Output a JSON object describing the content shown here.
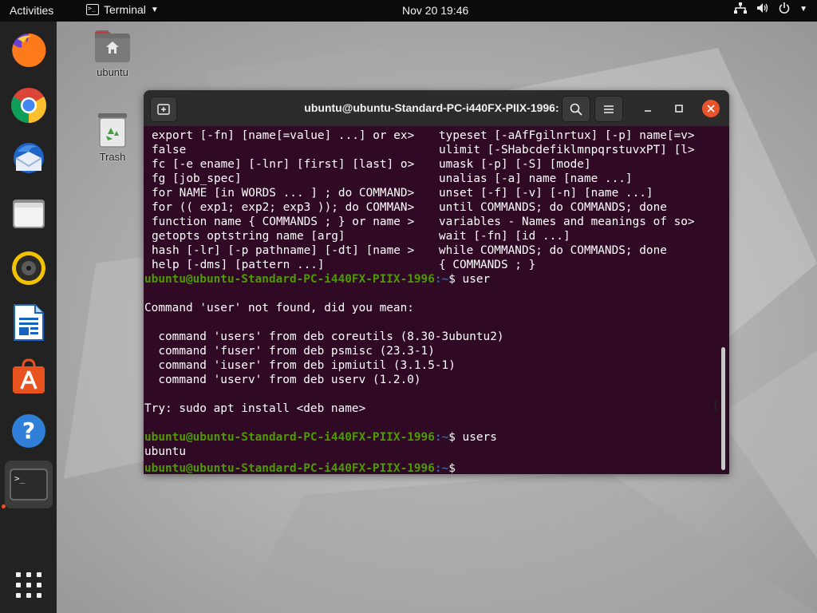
{
  "topbar": {
    "activities": "Activities",
    "app_name": "Terminal",
    "clock": "Nov 20  19:46"
  },
  "dock": {
    "items": [
      "firefox",
      "chrome",
      "thunderbird",
      "files",
      "rhythmbox",
      "libreoffice-writer",
      "ubuntu-software",
      "help",
      "terminal",
      "show-applications"
    ]
  },
  "desktop": {
    "home_label": "ubuntu",
    "trash_label": "Trash"
  },
  "window": {
    "title": "ubuntu@ubuntu-Standard-PC-i440FX-PIIX-1996: ~"
  },
  "terminal": {
    "help_rows": [
      {
        "left": "export [-fn] [name[=value] ...] or ex>",
        "right": "typeset [-aAfFgilnrtux] [-p] name[=v>"
      },
      {
        "left": "false",
        "right": "ulimit [-SHabcdefiklmnpqrstuvxPT] [l>"
      },
      {
        "left": "fc [-e ename] [-lnr] [first] [last] o>",
        "right": "umask [-p] [-S] [mode]"
      },
      {
        "left": "fg [job_spec]",
        "right": "unalias [-a] name [name ...]"
      },
      {
        "left": "for NAME [in WORDS ... ] ; do COMMAND>",
        "right": "unset [-f] [-v] [-n] [name ...]"
      },
      {
        "left": "for (( exp1; exp2; exp3 )); do COMMAN>",
        "right": "until COMMANDS; do COMMANDS; done"
      },
      {
        "left": "function name { COMMANDS ; } or name >",
        "right": "variables - Names and meanings of so>"
      },
      {
        "left": "getopts optstring name [arg]",
        "right": "wait [-fn] [id ...]"
      },
      {
        "left": "hash [-lr] [-p pathname] [-dt] [name >",
        "right": "while COMMANDS; do COMMANDS; done"
      },
      {
        "left": "help [-dms] [pattern ...]",
        "right": "{ COMMANDS ; }"
      }
    ],
    "prompt_user": "ubuntu@ubuntu-Standard-PC-i440FX-PIIX-1996",
    "prompt_path": ":~",
    "prompt_sym": "$ ",
    "cmd1": "user",
    "not_found": "Command 'user' not found, did you mean:",
    "suggestions": [
      "  command 'users' from deb coreutils (8.30-3ubuntu2)",
      "  command 'fuser' from deb psmisc (23.3-1)",
      "  command 'iuser' from deb ipmiutil (3.1.5-1)",
      "  command 'userv' from deb userv (1.2.0)"
    ],
    "try_line": "Try: sudo apt install <deb name>",
    "cmd2": "users",
    "output2": "ubuntu"
  },
  "colors": {
    "terminal_bg": "#300a24",
    "prompt_user": "#4e9a06",
    "prompt_path": "#3465a4",
    "close_button": "#e9542d"
  }
}
